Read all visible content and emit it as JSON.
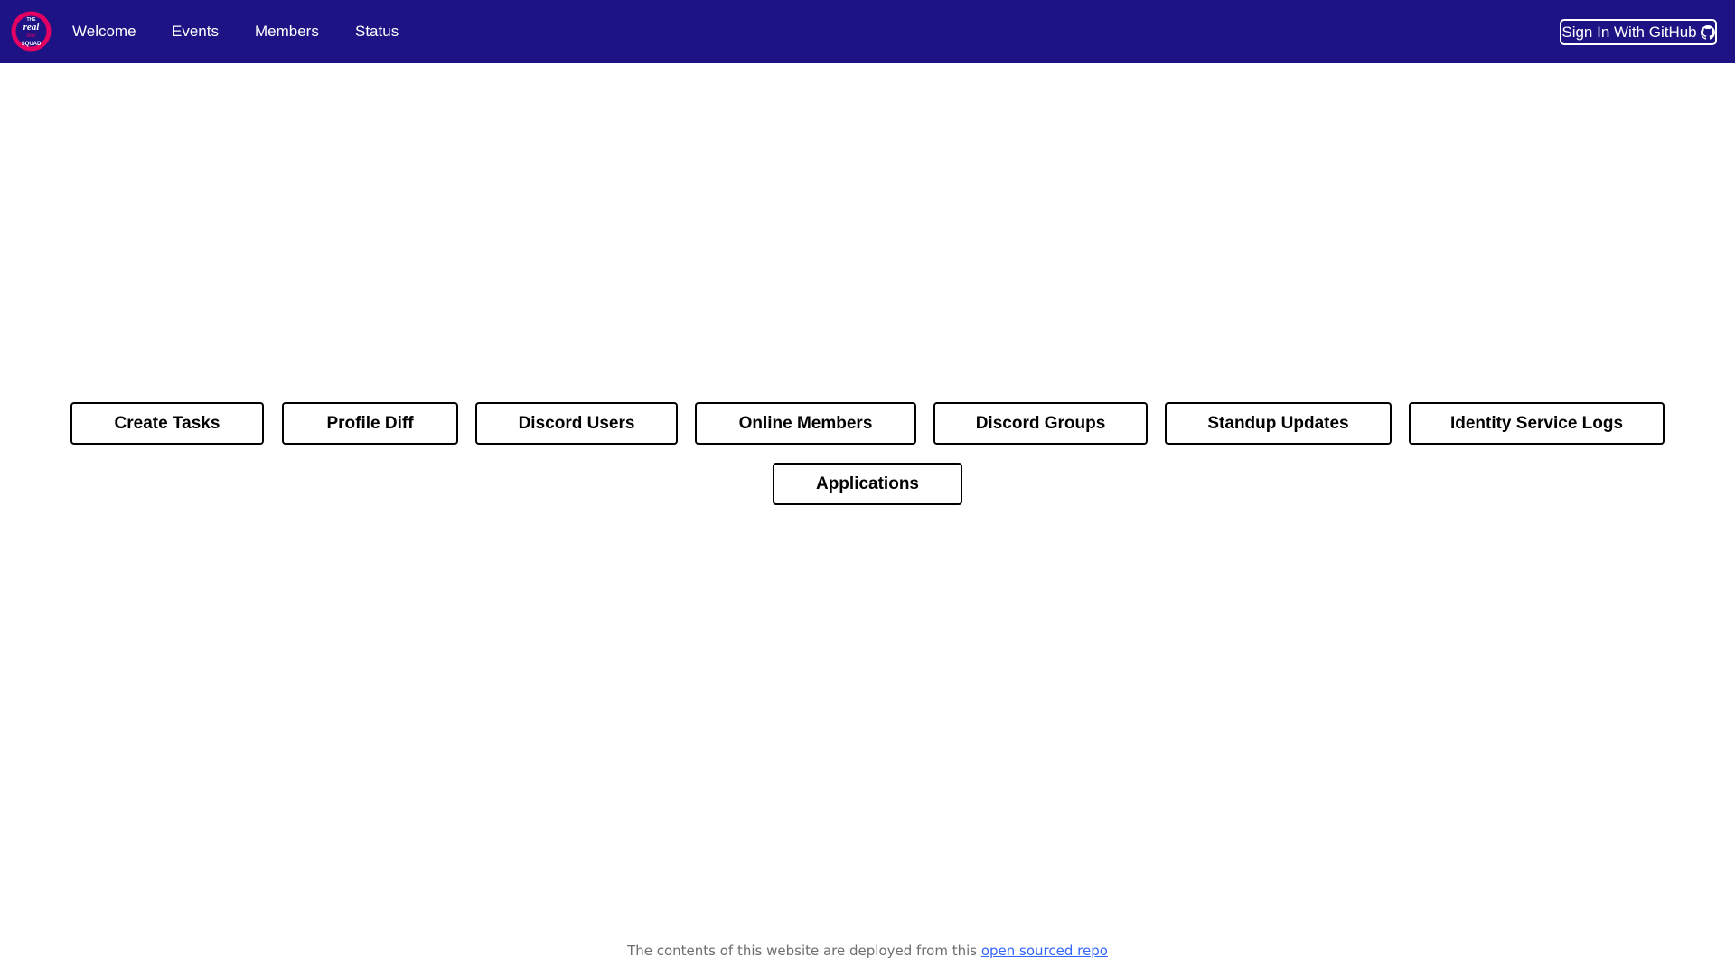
{
  "navbar": {
    "background": "#1d1384",
    "logo": {
      "lines": [
        "THE",
        "real",
        "dev",
        "SQUAD"
      ],
      "icon": "real-dev-squad-logo"
    },
    "links": [
      {
        "label": "Welcome"
      },
      {
        "label": "Events"
      },
      {
        "label": "Members"
      },
      {
        "label": "Status"
      }
    ],
    "signin": {
      "label": "Sign In With GitHub",
      "icon": "github-icon"
    }
  },
  "dashboard": {
    "buttons": [
      {
        "label": "Create Tasks"
      },
      {
        "label": "Profile Diff"
      },
      {
        "label": "Discord Users"
      },
      {
        "label": "Online Members"
      },
      {
        "label": "Discord Groups"
      },
      {
        "label": "Standup Updates"
      },
      {
        "label": "Identity Service Logs"
      },
      {
        "label": "Applications"
      }
    ]
  },
  "footer": {
    "text": "The contents of this website are deployed from this ",
    "link_label": "open sourced repo",
    "link_color": "#3366ff"
  }
}
